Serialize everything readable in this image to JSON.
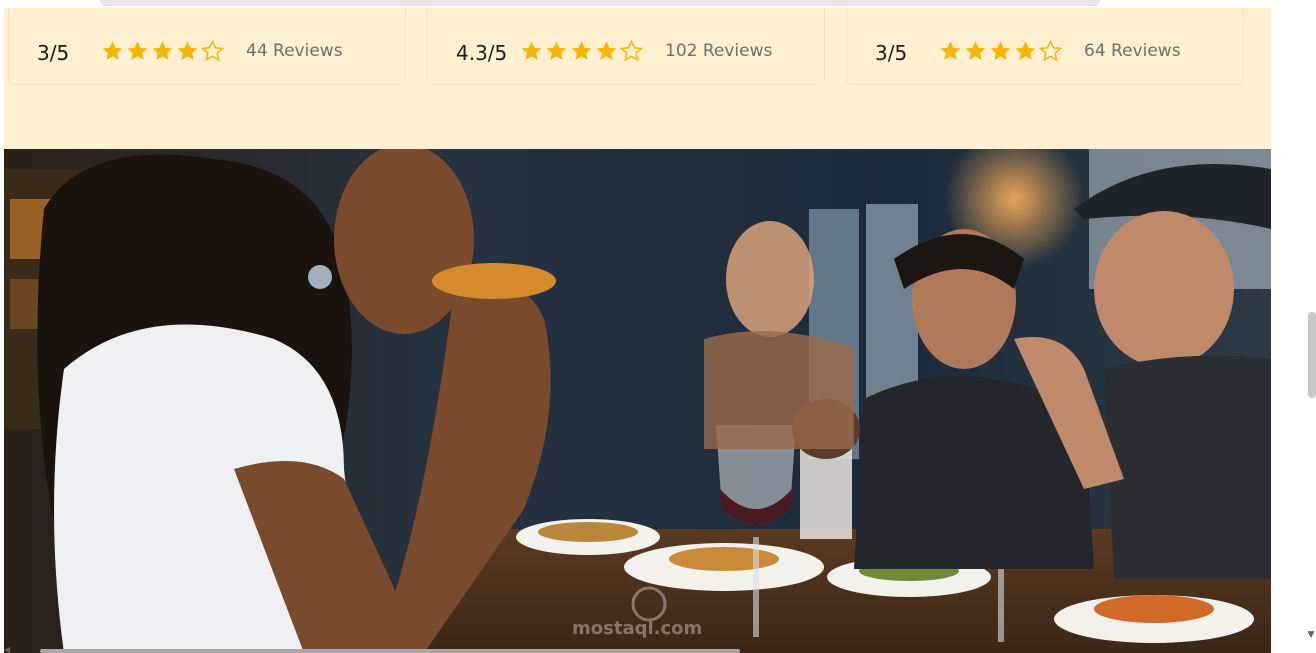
{
  "ratings": [
    {
      "score": "3/5",
      "stars_filled": 4,
      "stars_total": 5,
      "reviews": "44 Reviews"
    },
    {
      "score": "4.3/5",
      "stars_filled": 4,
      "stars_total": 5,
      "reviews": "102 Reviews"
    },
    {
      "score": "3/5",
      "stars_filled": 4,
      "stars_total": 5,
      "reviews": "64 Reviews"
    }
  ],
  "colors": {
    "band_background": "#fff0d2",
    "star": "#f5b50a",
    "score_text": "#1d1d1d",
    "reviews_text": "#6f6f6f"
  },
  "icons": {
    "star_filled": "star-icon",
    "star_empty": "star-outline-icon",
    "scroll_down": "chevron-down-icon"
  },
  "hero": {
    "content": "restaurant-photo",
    "watermark": "mostaql.com"
  }
}
